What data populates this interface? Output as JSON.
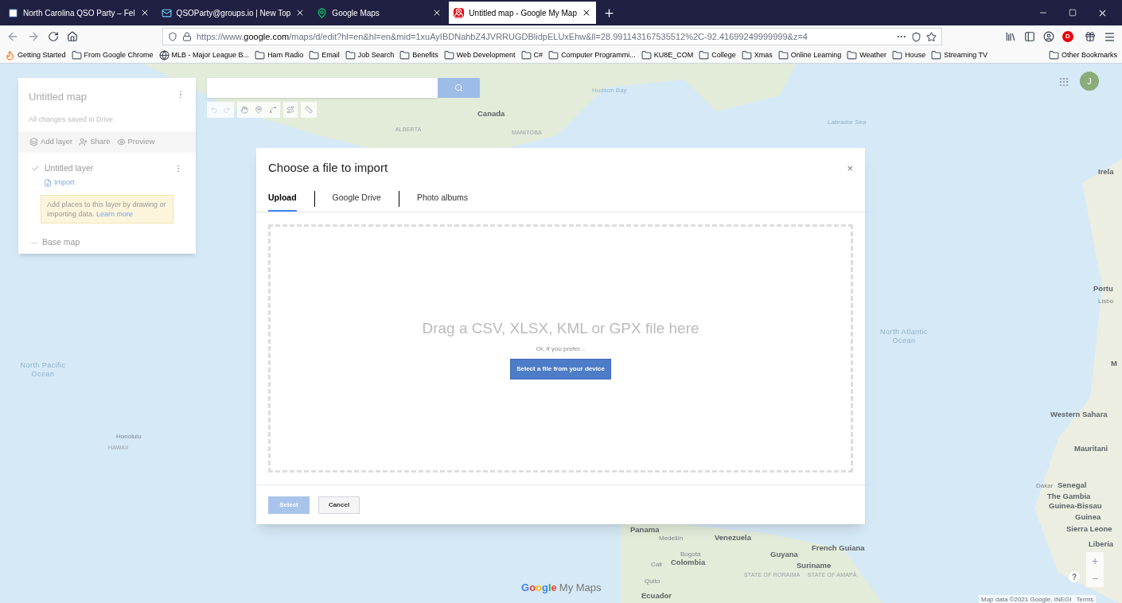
{
  "browser": {
    "tabs": [
      {
        "title": "North Carolina QSO Party – Fel",
        "selected": false,
        "kind": "site"
      },
      {
        "title": "QSOParty@groups.io | New Top",
        "selected": false,
        "kind": "mail"
      },
      {
        "title": "Google Maps",
        "selected": false,
        "kind": "maps"
      },
      {
        "title": "Untitled map - Google My Map",
        "selected": true,
        "kind": "mymaps"
      }
    ],
    "url": "https://www.**google.com**/maps/d/edit?hl=en&hl=en&mid=1xuAyIBDNahbZ4JVRRUGDBlidpELUxEhw&ll=28.991143167535512%2C-92.41699249999999&z=4",
    "url_menu": "···",
    "bookmarks": [
      {
        "label": "Getting Started",
        "kind": "firefox"
      },
      {
        "label": "From Google Chrome",
        "kind": "folder"
      },
      {
        "label": "MLB - Major League B...",
        "kind": "globe"
      },
      {
        "label": "Ham Radio",
        "kind": "folder"
      },
      {
        "label": "Email",
        "kind": "folder"
      },
      {
        "label": "Job Search",
        "kind": "folder"
      },
      {
        "label": "Benefits",
        "kind": "folder"
      },
      {
        "label": "Web Development",
        "kind": "folder"
      },
      {
        "label": "C#",
        "kind": "folder"
      },
      {
        "label": "Computer Programmi...",
        "kind": "folder"
      },
      {
        "label": "KU8E_COM",
        "kind": "folder"
      },
      {
        "label": "College",
        "kind": "folder"
      },
      {
        "label": "Xmas",
        "kind": "folder"
      },
      {
        "label": "Online Learning",
        "kind": "folder"
      },
      {
        "label": "Weather",
        "kind": "folder"
      },
      {
        "label": "House",
        "kind": "folder"
      },
      {
        "label": "Streaming TV",
        "kind": "folder"
      }
    ],
    "other_bookmarks": "Other Bookmarks",
    "extension_badge": "D"
  },
  "map_panel": {
    "title": "Untitled map",
    "status": "All changes saved in Drive",
    "actions": [
      {
        "label": "Add layer",
        "kind": "layers"
      },
      {
        "label": "Share",
        "kind": "share"
      },
      {
        "label": "Preview",
        "kind": "preview"
      }
    ],
    "layer": {
      "name": "Untitled layer",
      "checked": true,
      "import": "Import",
      "hint": "Add places to this layer by drawing or importing data.",
      "hint_link": "Learn more"
    },
    "base_map": "Base map"
  },
  "map_labels": [
    {
      "text": "Canada",
      "kind": "country"
    },
    {
      "text": "ALBERTA",
      "kind": "region"
    },
    {
      "text": "MANITOBA",
      "kind": "region"
    },
    {
      "text": "Hudson Bay",
      "kind": "water"
    },
    {
      "text": "Labrador Sea",
      "kind": "water"
    },
    {
      "text": "North Pacific Ocean",
      "kind": "ocean"
    },
    {
      "text": "Honolulu",
      "kind": "city"
    },
    {
      "text": "HAWAII",
      "kind": "region"
    },
    {
      "text": "North Atlantic Ocean",
      "kind": "ocean"
    },
    {
      "text": "Irela",
      "kind": "country"
    },
    {
      "text": "Portu",
      "kind": "country"
    },
    {
      "text": "Lisbo",
      "kind": "city"
    },
    {
      "text": "M",
      "kind": "country"
    },
    {
      "text": "Western Sahara",
      "kind": "country"
    },
    {
      "text": "Mauritani",
      "kind": "country"
    },
    {
      "text": "Dakar",
      "kind": "city"
    },
    {
      "text": "Senegal",
      "kind": "country"
    },
    {
      "text": "The Gambia",
      "kind": "country"
    },
    {
      "text": "Guinea-Bissau",
      "kind": "country"
    },
    {
      "text": "Guinea",
      "kind": "country"
    },
    {
      "text": "Sierra Leone",
      "kind": "country"
    },
    {
      "text": "Liberia",
      "kind": "country"
    },
    {
      "text": "Panama",
      "kind": "country"
    },
    {
      "text": "Medellín",
      "kind": "city"
    },
    {
      "text": "Venezuela",
      "kind": "country"
    },
    {
      "text": "Bogota",
      "kind": "city"
    },
    {
      "text": "Cali",
      "kind": "city"
    },
    {
      "text": "Colombia",
      "kind": "country"
    },
    {
      "text": "Guyana",
      "kind": "country"
    },
    {
      "text": "French Guiana",
      "kind": "country"
    },
    {
      "text": "Suriname",
      "kind": "country"
    },
    {
      "text": "STATE OF RORAIMA",
      "kind": "region"
    },
    {
      "text": "STATE OF AMAPÁ",
      "kind": "region"
    },
    {
      "text": "Quito",
      "kind": "city"
    },
    {
      "text": "Ecuador",
      "kind": "country"
    }
  ],
  "logo": {
    "brand": "Google",
    "product": "My Maps"
  },
  "avatar": "J",
  "zoom": {
    "in": "+",
    "out": "−",
    "help": "?"
  },
  "attribution": {
    "text": "Map data ©2021 Google, INEGI",
    "terms": "Terms"
  },
  "dialog": {
    "title": "Choose a file to import",
    "close": "×",
    "tabs": [
      {
        "label": "Upload",
        "selected": true
      },
      {
        "label": "Google Drive",
        "selected": false
      },
      {
        "label": "Photo albums",
        "selected": false
      }
    ],
    "drop_text": "Drag a CSV, XLSX, KML or GPX file here",
    "or_text": "Or, if you prefer...",
    "device_button": "Select a file from your device",
    "select": {
      "label": "Select",
      "disabled": true
    },
    "cancel": "Cancel"
  }
}
